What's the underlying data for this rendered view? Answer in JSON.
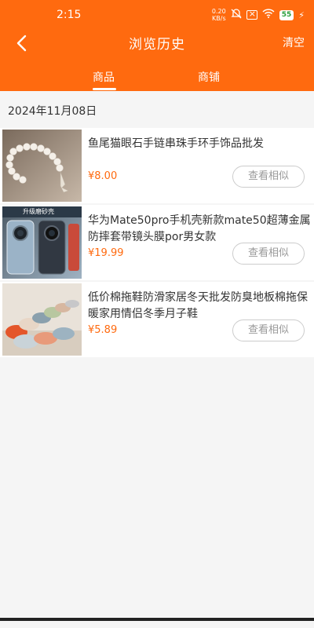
{
  "status_bar": {
    "time": "2:15",
    "speed_value": "0.20",
    "speed_unit": "KB/s",
    "battery": "55"
  },
  "header": {
    "title": "浏览历史",
    "clear_label": "清空",
    "back_icon": "chevron-left-icon"
  },
  "tabs": [
    {
      "label": "商品",
      "active": true
    },
    {
      "label": "商铺",
      "active": false
    }
  ],
  "date_group": "2024年11月08日",
  "items": [
    {
      "title": "鱼尾猫眼石手链串珠手环手饰品批发",
      "price": "¥8.00",
      "similar_label": "查看相似",
      "thumb": "bracelet-image"
    },
    {
      "title": "华为Mate50pro手机壳新款mate50超薄金属防摔套带镜头膜por男女款",
      "price": "¥19.99",
      "similar_label": "查看相似",
      "thumb": "phone-case-image",
      "thumb_badge": "升级磨砂壳"
    },
    {
      "title": "低价棉拖鞋防滑家居冬天批发防臭地板棉拖保暖家用情侣冬季月子鞋",
      "price": "¥5.89",
      "similar_label": "查看相似",
      "thumb": "slippers-image"
    }
  ],
  "colors": {
    "accent": "#ff6a0f",
    "background": "#f5f5f5"
  }
}
